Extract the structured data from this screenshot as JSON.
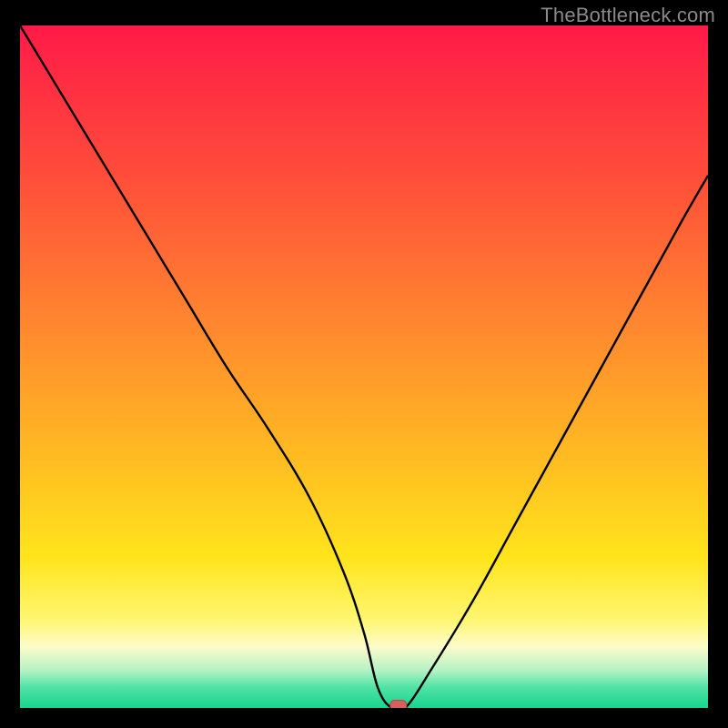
{
  "watermark": "TheBottleneck.com",
  "colors": {
    "frame": "#000000",
    "curve": "#000000",
    "marker_fill": "#d9605a",
    "marker_stroke": "#b24a44",
    "gradient_stops": [
      {
        "offset": 0.0,
        "color": "#ff1a48"
      },
      {
        "offset": 0.22,
        "color": "#ff4d3a"
      },
      {
        "offset": 0.45,
        "color": "#ff8a2e"
      },
      {
        "offset": 0.62,
        "color": "#ffb822"
      },
      {
        "offset": 0.78,
        "color": "#ffe41c"
      },
      {
        "offset": 0.87,
        "color": "#fff670"
      },
      {
        "offset": 0.91,
        "color": "#fdfccb"
      },
      {
        "offset": 0.945,
        "color": "#b4f2c4"
      },
      {
        "offset": 0.97,
        "color": "#4fe3a4"
      },
      {
        "offset": 1.0,
        "color": "#18d38f"
      }
    ]
  },
  "chart_data": {
    "type": "line",
    "title": "",
    "xlabel": "",
    "ylabel": "",
    "xlim": [
      0,
      100
    ],
    "ylim": [
      0,
      100
    ],
    "series": [
      {
        "name": "bottleneck-curve",
        "x": [
          0,
          6,
          12,
          18,
          24,
          30,
          36,
          42,
          47,
          50,
          52,
          54,
          56,
          60,
          66,
          72,
          78,
          84,
          90,
          96,
          100
        ],
        "values": [
          100,
          90,
          80,
          70,
          60,
          50,
          41,
          31,
          20,
          11,
          3,
          0,
          0,
          6,
          16,
          27,
          38,
          49,
          60,
          71,
          78
        ]
      }
    ],
    "annotations": [
      {
        "name": "optimal-marker",
        "x": 55,
        "y": 0
      }
    ]
  }
}
